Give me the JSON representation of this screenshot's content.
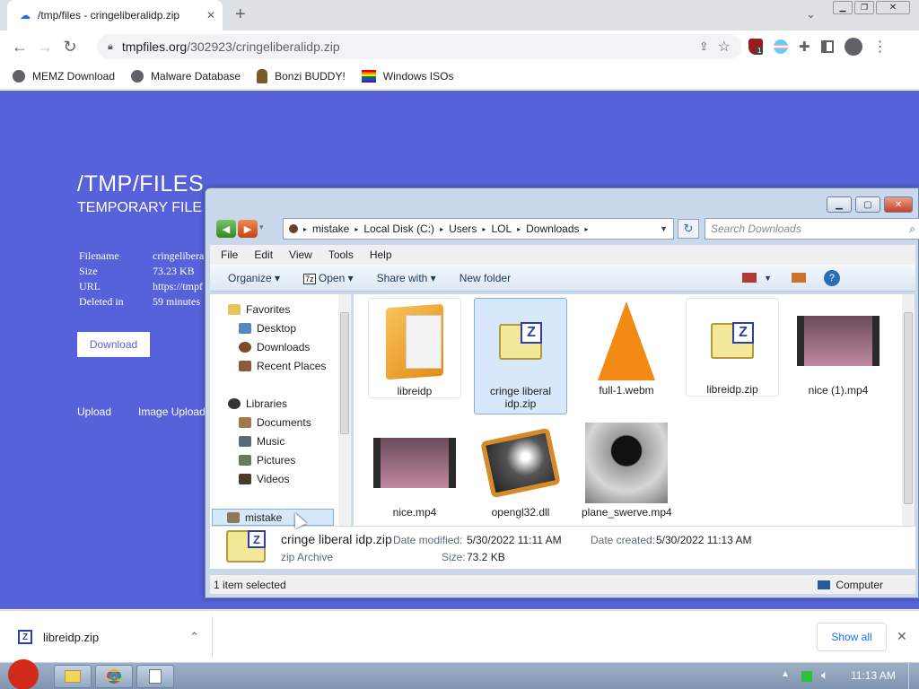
{
  "browser": {
    "tab_title": "/tmp/files - cringeliberalidp.zip",
    "new_tab": "+",
    "url_host": "tmpfiles.org",
    "url_path": "/302923/cringeliberalidp.zip",
    "bookmarks": [
      {
        "label": "MEMZ Download",
        "icon": "globe-icon"
      },
      {
        "label": "Malware Database",
        "icon": "globe-icon"
      },
      {
        "label": "Bonzi BUDDY!",
        "icon": "bonzi-icon"
      },
      {
        "label": "Windows ISOs",
        "icon": "rainbow-flag-icon"
      }
    ],
    "extension_badge": "1"
  },
  "page": {
    "title": "/TMP/FILES",
    "subtitle": "TEMPORARY FILE",
    "info": [
      {
        "label": "Filename",
        "value": "cringelibera"
      },
      {
        "label": "Size",
        "value": "73.23 KB"
      },
      {
        "label": "URL",
        "value": "https://tmpf"
      },
      {
        "label": "Deleted in",
        "value": "59 minutes"
      }
    ],
    "download_button": "Download",
    "links": [
      "Upload",
      "Image Upload"
    ],
    "accent": "#5761d9"
  },
  "explorer": {
    "path": [
      "mistake",
      "Local Disk (C:)",
      "Users",
      "LOL",
      "Downloads"
    ],
    "search_placeholder": "Search Downloads",
    "menu": [
      "File",
      "Edit",
      "View",
      "Tools",
      "Help"
    ],
    "commands": [
      "Organize",
      "Open",
      "Share with",
      "New folder"
    ],
    "nav": {
      "favorites": "Favorites",
      "favorites_items": [
        "Desktop",
        "Downloads",
        "Recent Places"
      ],
      "libraries": "Libraries",
      "libraries_items": [
        "Documents",
        "Music",
        "Pictures",
        "Videos"
      ],
      "computer": "mistake"
    },
    "files": [
      {
        "name": "libreidp",
        "type": "folder"
      },
      {
        "name": "cringe liberal idp.zip",
        "type": "zip",
        "selected": true
      },
      {
        "name": "full-1.webm",
        "type": "vlc"
      },
      {
        "name": "libreidp.zip",
        "type": "zip"
      },
      {
        "name": "nice (1).mp4",
        "type": "video"
      },
      {
        "name": "nice.mp4",
        "type": "video"
      },
      {
        "name": "opengl32.dll",
        "type": "dll"
      },
      {
        "name": "plane_swerve.mp4",
        "type": "video-dark"
      }
    ],
    "details": {
      "name": "cringe liberal idp.zip",
      "kind": "zip Archive",
      "modified_label": "Date modified:",
      "modified": "5/30/2022 11:11 AM",
      "size_label": "Size:",
      "size": "73.2 KB",
      "created_label": "Date created:",
      "created": "5/30/2022 11:13 AM"
    },
    "status": "1 item selected",
    "status_right": "Computer"
  },
  "shelf": {
    "file": "libreidp.zip",
    "show_all": "Show all"
  },
  "taskbar": {
    "clock": "11:13 AM"
  }
}
